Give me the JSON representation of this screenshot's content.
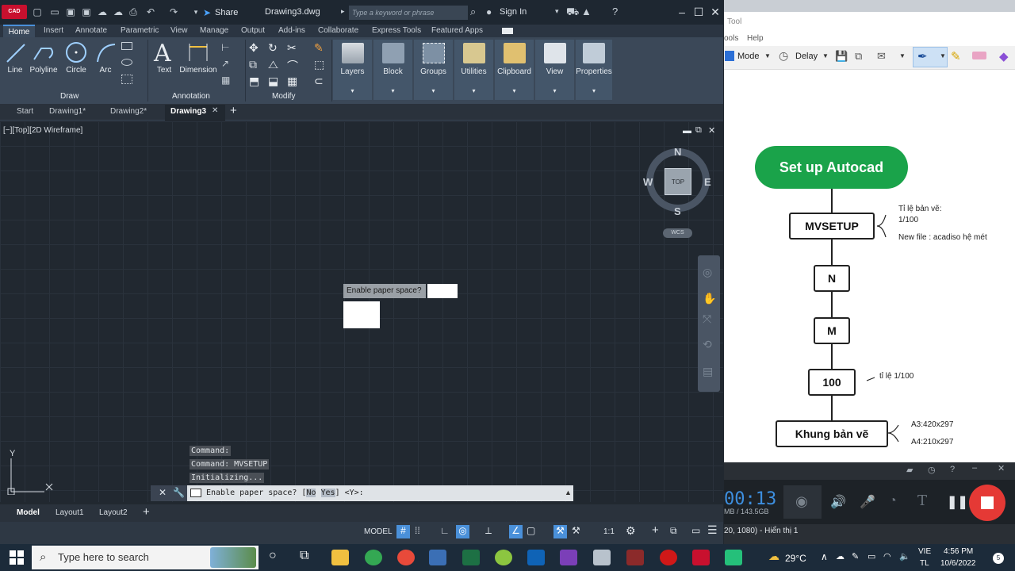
{
  "app": {
    "logo": "CAD",
    "file_title": "Drawing3.dwg",
    "share_label": "Share",
    "search_placeholder": "Type a keyword or phrase",
    "sign_in": "Sign In"
  },
  "ribbon_tabs": [
    "Home",
    "Insert",
    "Annotate",
    "Parametric",
    "View",
    "Manage",
    "Output",
    "Add-ins",
    "Collaborate",
    "Express Tools",
    "Featured Apps"
  ],
  "ribbon": {
    "draw": {
      "group": "Draw",
      "line": "Line",
      "polyline": "Polyline",
      "circle": "Circle",
      "arc": "Arc"
    },
    "annotation": {
      "group": "Annotation",
      "text": "Text",
      "dimension": "Dimension"
    },
    "modify": {
      "group": "Modify"
    },
    "big": {
      "layers": "Layers",
      "block": "Block",
      "groups": "Groups",
      "utilities": "Utilities",
      "clipboard": "Clipboard",
      "view": "View",
      "properties": "Properties"
    }
  },
  "file_tabs": [
    "Start",
    "Drawing1*",
    "Drawing2*",
    "Drawing3"
  ],
  "viewport_label": "[−][Top][2D Wireframe]",
  "viewcube": {
    "top": "TOP",
    "n": "N",
    "s": "S",
    "e": "E",
    "w": "W",
    "wcs": "WCS"
  },
  "ucs": {
    "y": "Y"
  },
  "dialog": {
    "prompt": "Enable paper space?"
  },
  "command_history": [
    "Command:",
    "Command: MVSETUP",
    "Initializing..."
  ],
  "command_line": {
    "before": "Enable paper space? [",
    "no": "No",
    "yes": "Yes",
    "after": "] <Y>:"
  },
  "layout_tabs": [
    "Model",
    "Layout1",
    "Layout2"
  ],
  "status": {
    "model": "MODEL",
    "scale": "1:1"
  },
  "right_window": {
    "title_fragment": "Tool",
    "menu_fragment_1": "ools",
    "menu_fragment_2": "Help",
    "mode_label": "Mode",
    "delay_label": "Delay",
    "mindmap": {
      "root": "Set up Autocad",
      "n1": "MVSETUP",
      "n1_note_1": "Tỉ lệ bản vẽ:",
      "n1_note_2": "1/100",
      "n1_note_3": "New file : acadiso hệ mét",
      "n2": "N",
      "n3": "M",
      "n4": "100",
      "n4_note": "tỉ lệ 1/100",
      "n5": "Khung bản vẽ",
      "n5_note_1": "A3:420x297",
      "n5_note_2": "A4:210x297"
    },
    "timer": "00:13",
    "storage": "MB / 143.5GB",
    "status_text": "20, 1080) - Hiển thị 1"
  },
  "taskbar": {
    "search": "Type here to search",
    "temp": "29°C",
    "lang_1": "VIE",
    "lang_2": "TL",
    "time": "4:56 PM",
    "date": "10/6/2022"
  },
  "colors": {
    "mindmap_root": "#1aa34a",
    "record": "#e53935",
    "autocad_red": "#c8102e"
  }
}
